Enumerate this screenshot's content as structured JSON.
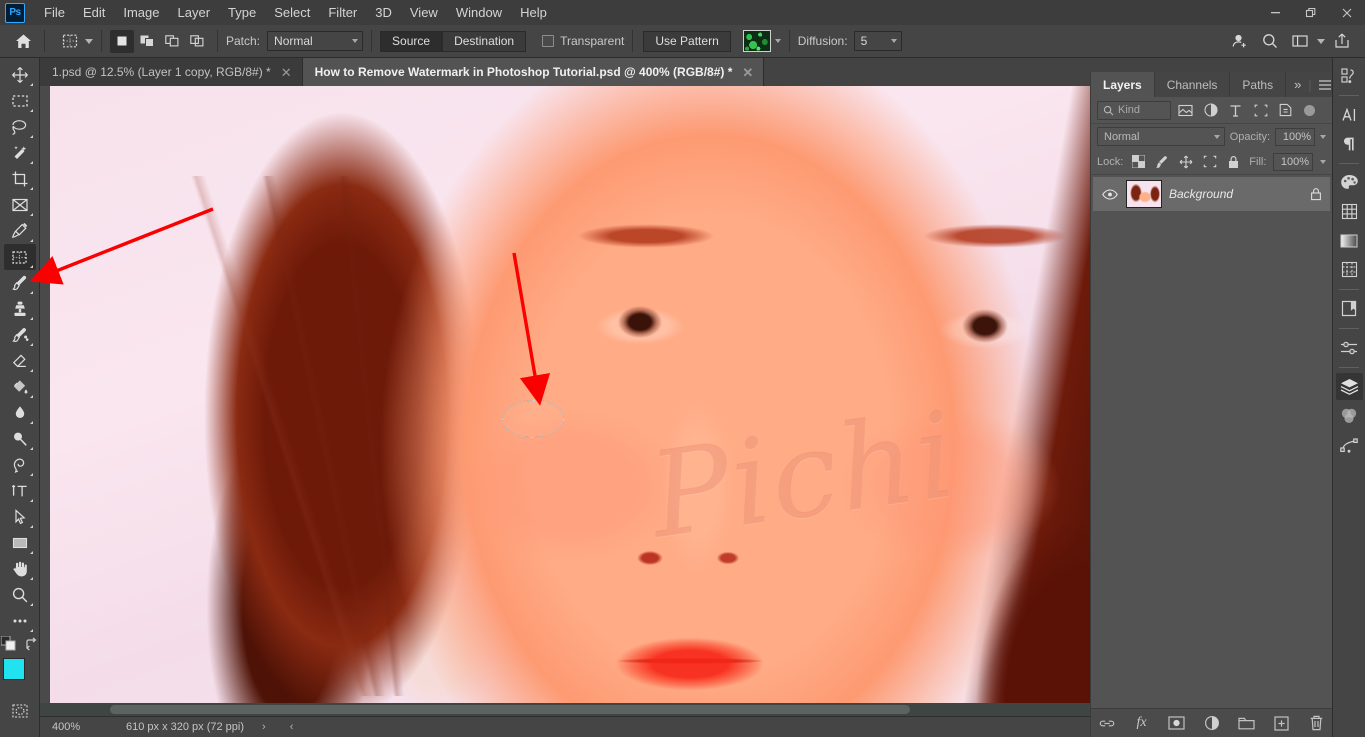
{
  "app": {
    "name": "Adobe Photoshop",
    "logo_text": "Ps"
  },
  "menubar": {
    "items": [
      {
        "label": "File"
      },
      {
        "label": "Edit"
      },
      {
        "label": "Image"
      },
      {
        "label": "Layer"
      },
      {
        "label": "Type"
      },
      {
        "label": "Select"
      },
      {
        "label": "Filter"
      },
      {
        "label": "3D"
      },
      {
        "label": "View"
      },
      {
        "label": "Window"
      },
      {
        "label": "Help"
      }
    ],
    "window_controls": {
      "minimize": "—",
      "restore": "❐",
      "close": "✕"
    }
  },
  "options_bar": {
    "home_icon": "home-icon",
    "tool_icon": "patch-tool-icon",
    "selection_modes": [
      "new-selection",
      "add-to-selection",
      "subtract-from-selection",
      "intersect-with-selection"
    ],
    "patch_label": "Patch:",
    "patch_mode": "Normal",
    "source_label": "Source",
    "destination_label": "Destination",
    "transparent_label": "Transparent",
    "transparent_checked": false,
    "use_pattern_label": "Use Pattern",
    "pattern_swatch": "green-camouflage-pattern",
    "diffusion_label": "Diffusion:",
    "diffusion_value": "5",
    "right_icons": [
      "add-collaborator-icon",
      "search-icon",
      "workspace-icon",
      "chevron-down-icon",
      "share-icon"
    ]
  },
  "tabs": [
    {
      "label": "1.psd @ 12.5% (Layer 1 copy, RGB/8#) *",
      "active": false,
      "close": "✕"
    },
    {
      "label": "How to Remove Watermark in Photoshop Tutorial.psd @ 400% (RGB/8#) *",
      "active": true,
      "close": "✕"
    }
  ],
  "toolbar": {
    "tools": [
      {
        "name": "move-tool",
        "active": false
      },
      {
        "name": "rectangular-marquee-tool",
        "active": false
      },
      {
        "name": "lasso-tool",
        "active": false
      },
      {
        "name": "object-selection-tool",
        "active": false
      },
      {
        "name": "crop-tool",
        "active": false
      },
      {
        "name": "frame-tool",
        "active": false
      },
      {
        "name": "eyedropper-tool",
        "active": false
      },
      {
        "name": "patch-tool",
        "active": true
      },
      {
        "name": "brush-tool",
        "active": false
      },
      {
        "name": "clone-stamp-tool",
        "active": false
      },
      {
        "name": "history-brush-tool",
        "active": false
      },
      {
        "name": "eraser-tool",
        "active": false
      },
      {
        "name": "gradient-tool",
        "active": false
      },
      {
        "name": "blur-tool",
        "active": false
      },
      {
        "name": "dodge-tool",
        "active": false
      },
      {
        "name": "pen-tool",
        "active": false
      },
      {
        "name": "type-tool",
        "active": false
      },
      {
        "name": "path-selection-tool",
        "active": false
      },
      {
        "name": "rectangle-tool",
        "active": false
      },
      {
        "name": "hand-tool",
        "active": false
      },
      {
        "name": "zoom-tool",
        "active": false
      },
      {
        "name": "edit-toolbar-tool",
        "active": false
      }
    ],
    "foreground_color": "#21e3f0",
    "background_color": "#ffffff"
  },
  "canvas": {
    "document_name": "How to Remove Watermark in Photoshop Tutorial.psd",
    "watermark_text": "Pichi",
    "selection": "marching-ants-selection-on-cheek",
    "annotations": [
      {
        "name": "arrow-to-patch-tool",
        "color": "#ff0000"
      },
      {
        "name": "arrow-to-selection",
        "color": "#ff0000"
      }
    ]
  },
  "statusbar": {
    "zoom": "400%",
    "doc_size": "610 px x 320 px (72 ppi)",
    "expand_arrow": "›",
    "collapse_arrow": "‹"
  },
  "right_dock": {
    "icons": [
      {
        "name": "libraries-icon",
        "active": false
      },
      {
        "name": "character-icon",
        "active": false
      },
      {
        "name": "paragraph-icon",
        "active": false
      },
      {
        "name": "color-icon",
        "active": false
      },
      {
        "name": "swatches-icon",
        "active": false
      },
      {
        "name": "gradients-icon",
        "active": false
      },
      {
        "name": "patterns-icon",
        "active": false
      },
      {
        "name": "notes-icon",
        "active": false
      },
      {
        "name": "adjustments-icon",
        "active": false
      },
      {
        "name": "layers-icon",
        "active": true
      },
      {
        "name": "channels-icon",
        "active": false
      },
      {
        "name": "paths-icon",
        "active": false
      }
    ]
  },
  "layers_panel": {
    "tabs": [
      {
        "label": "Layers",
        "active": true
      },
      {
        "label": "Channels",
        "active": false
      },
      {
        "label": "Paths",
        "active": false
      }
    ],
    "collapse_icon": "»",
    "menu_icon": "panel-menu-icon",
    "filter_placeholder": "Kind",
    "filter_icons": [
      "pixel-filter-icon",
      "adjustment-filter-icon",
      "type-filter-icon",
      "shape-filter-icon",
      "smart-object-filter-icon"
    ],
    "blend_mode": "Normal",
    "opacity_label": "Opacity:",
    "opacity_value": "100%",
    "lock_label": "Lock:",
    "lock_icons": [
      "lock-transparent-pixels-icon",
      "lock-image-pixels-icon",
      "lock-position-icon",
      "lock-artboard-icon",
      "lock-all-icon"
    ],
    "fill_label": "Fill:",
    "fill_value": "100%",
    "layers": [
      {
        "name": "Background",
        "visible": true,
        "locked": true,
        "thumbnail": "portrait-thumbnail"
      }
    ],
    "footer_icons": [
      {
        "name": "link-layers-icon"
      },
      {
        "name": "layer-style-fx-icon",
        "label": "fx"
      },
      {
        "name": "add-layer-mask-icon"
      },
      {
        "name": "new-adjustment-layer-icon"
      },
      {
        "name": "new-group-icon"
      },
      {
        "name": "new-layer-icon"
      },
      {
        "name": "delete-layer-icon"
      }
    ]
  }
}
